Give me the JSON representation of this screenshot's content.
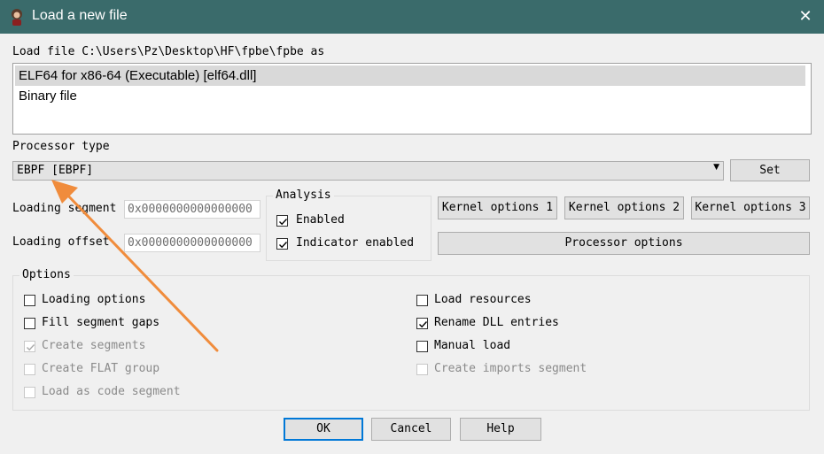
{
  "window": {
    "title": "Load a new file"
  },
  "load_file_label": "Load file C:\\Users\\Pz\\Desktop\\HF\\fpbe\\fpbe as",
  "formats": [
    {
      "label": "ELF64 for x86-64 (Executable) [elf64.dll]",
      "selected": true
    },
    {
      "label": "Binary file",
      "selected": false
    }
  ],
  "processor": {
    "label": "Processor type",
    "value": "EBPF [EBPF]",
    "set_button": "Set"
  },
  "loading": {
    "segment_label": "Loading segment",
    "segment_value": "0x0000000000000000",
    "offset_label": "Loading offset",
    "offset_value": "0x0000000000000000"
  },
  "analysis": {
    "title": "Analysis",
    "enabled": {
      "label": "Enabled",
      "checked": true
    },
    "indicator": {
      "label": "Indicator enabled",
      "checked": true
    }
  },
  "kernel_buttons": [
    "Kernel options 1",
    "Kernel options 2",
    "Kernel options 3"
  ],
  "processor_options_button": "Processor options",
  "options": {
    "title": "Options",
    "left": [
      {
        "label": "Loading options",
        "checked": false,
        "disabled": false
      },
      {
        "label": "Fill segment gaps",
        "checked": false,
        "disabled": false
      },
      {
        "label": "Create segments",
        "checked": true,
        "disabled": true
      },
      {
        "label": "Create FLAT group",
        "checked": false,
        "disabled": true
      },
      {
        "label": "Load as code segment",
        "checked": false,
        "disabled": true
      }
    ],
    "right": [
      {
        "label": "Load resources",
        "checked": false,
        "disabled": false
      },
      {
        "label": "Rename DLL entries",
        "checked": true,
        "disabled": false
      },
      {
        "label": "Manual load",
        "checked": false,
        "disabled": false
      },
      {
        "label": "Create imports segment",
        "checked": false,
        "disabled": true
      }
    ]
  },
  "footer": {
    "ok": "OK",
    "cancel": "Cancel",
    "help": "Help"
  },
  "annotation": {
    "arrow_color": "#f08c3c"
  }
}
